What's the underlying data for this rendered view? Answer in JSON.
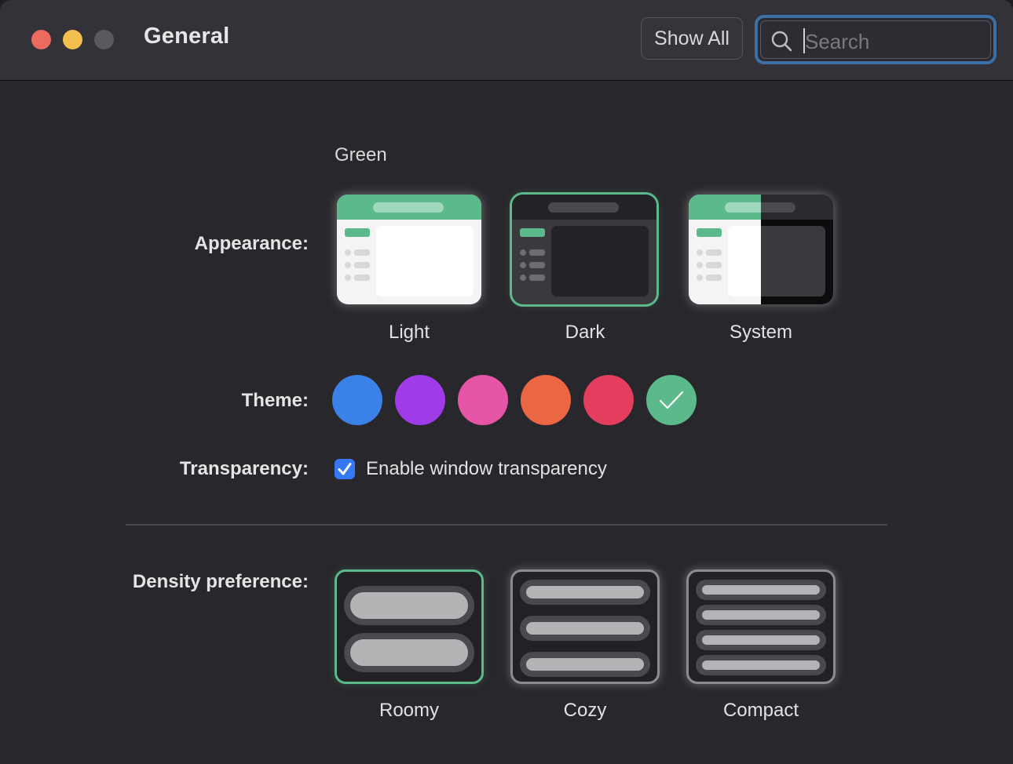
{
  "window": {
    "title": "General",
    "show_all_label": "Show All",
    "search_placeholder": "Search"
  },
  "appearance": {
    "label": "Appearance:",
    "accent_name": "Green",
    "options": [
      {
        "label": "Light",
        "selected": false
      },
      {
        "label": "Dark",
        "selected": true
      },
      {
        "label": "System",
        "selected": false
      }
    ]
  },
  "theme": {
    "label": "Theme:",
    "colors": [
      "#3a82e8",
      "#a03be8",
      "#e655a5",
      "#eb6642",
      "#e53d5e",
      "#5bb98b"
    ],
    "selected_index": 5
  },
  "transparency": {
    "label": "Transparency:",
    "checkbox_label": "Enable window transparency",
    "checked": true
  },
  "density": {
    "label": "Density preference:",
    "options": [
      {
        "label": "Roomy",
        "selected": true
      },
      {
        "label": "Cozy",
        "selected": false
      },
      {
        "label": "Compact",
        "selected": false
      }
    ]
  },
  "colors": {
    "accent": "#5bb98b",
    "focus_ring": "#3c6fa6",
    "checkbox": "#3478f6"
  }
}
